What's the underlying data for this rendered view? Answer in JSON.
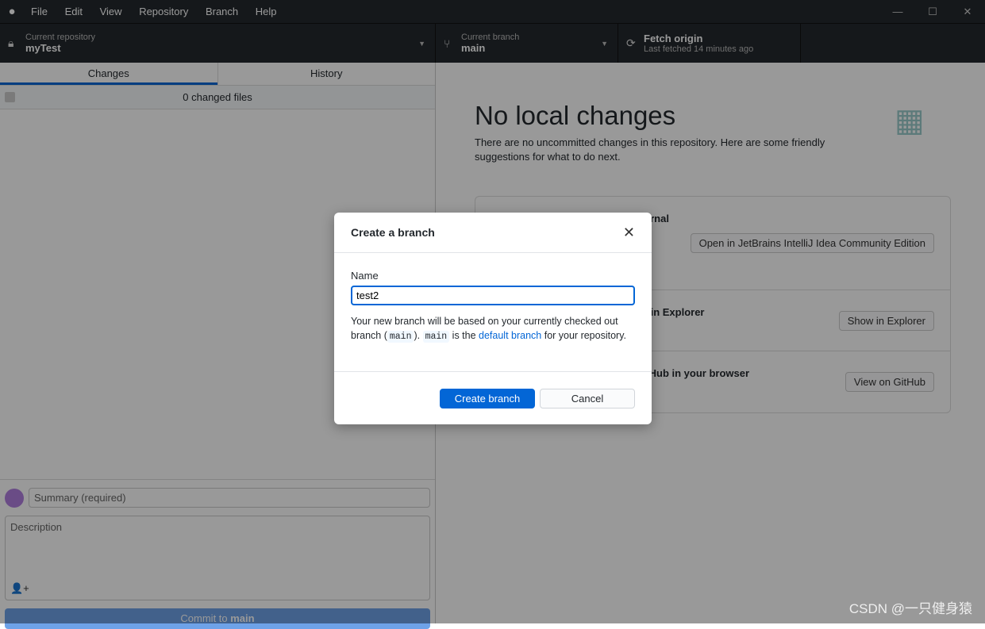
{
  "titlebar": {
    "menu": [
      "File",
      "Edit",
      "View",
      "Repository",
      "Branch",
      "Help"
    ]
  },
  "toolbar": {
    "repo": {
      "label": "Current repository",
      "value": "myTest"
    },
    "branch": {
      "label": "Current branch",
      "value": "main"
    },
    "fetch": {
      "label": "Fetch origin",
      "status": "Last fetched 14 minutes ago"
    }
  },
  "sidebar": {
    "tabs": [
      "Changes",
      "History"
    ],
    "changed_files": "0 changed files",
    "summary_placeholder": "Summary (required)",
    "description_placeholder": "Description",
    "commit_prefix": "Commit to ",
    "commit_branch": "main"
  },
  "main": {
    "title": "No local changes",
    "subtitle": "There are no uncommitted changes in this repository. Here are some friendly suggestions for what to do next.",
    "cards": [
      {
        "text": "Open the repository in your external",
        "button": "Open in JetBrains IntelliJ Idea Community Edition"
      },
      {
        "text": "View the files of your repository in Explorer",
        "button": "Show in Explorer"
      },
      {
        "text": "Open the repository page on GitHub in your browser",
        "button": "View on GitHub"
      }
    ]
  },
  "dialog": {
    "title": "Create a branch",
    "name_label": "Name",
    "name_value": "test2",
    "desc1": "Your new branch will be based on your currently checked out branch (",
    "code1": "main",
    "desc2": "). ",
    "code2": "main",
    "desc3": " is the ",
    "link": "default branch",
    "desc4": " for your repository.",
    "create": "Create branch",
    "cancel": "Cancel"
  },
  "watermark": "CSDN @一只健身猿",
  "colors": {
    "accent": "#0366d6",
    "toolbar": "#24292e"
  }
}
